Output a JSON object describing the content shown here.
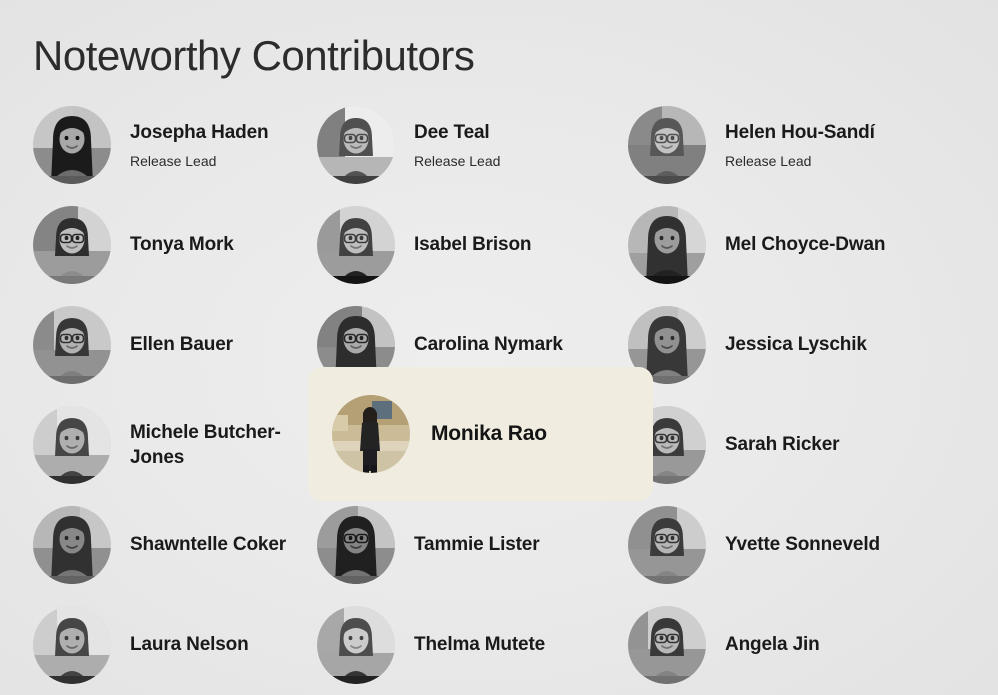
{
  "page": {
    "title": "Noteworthy Contributors",
    "background_color": "#e5e5e5",
    "title_color": "#2c2c2c"
  },
  "highlight": {
    "name": "Monika Rao",
    "background_color": "#f0ece0",
    "corner_radius": "14px"
  },
  "grid": {
    "columns": 3,
    "rows": 6,
    "rows_data": [
      [
        {
          "name": "Josepha Haden",
          "role": "Release Lead",
          "avatar": "avatar-josepha-haden"
        },
        {
          "name": "Dee Teal",
          "role": "Release Lead",
          "avatar": "avatar-dee-teal"
        },
        {
          "name": "Helen Hou-Sandí",
          "role": "Release Lead",
          "avatar": "avatar-helen-hou-sandi"
        }
      ],
      [
        {
          "name": "Tonya Mork",
          "role": "",
          "avatar": "avatar-tonya-mork"
        },
        {
          "name": "Isabel Brison",
          "role": "",
          "avatar": "avatar-isabel-brison"
        },
        {
          "name": "Mel Choyce-Dwan",
          "role": "",
          "avatar": "avatar-mel-choyce-dwan"
        }
      ],
      [
        {
          "name": "Ellen Bauer",
          "role": "",
          "avatar": "avatar-ellen-bauer"
        },
        {
          "name": "Carolina Nymark",
          "role": "",
          "avatar": "avatar-carolina-nymark"
        },
        {
          "name": "Jessica Lyschik",
          "role": "",
          "avatar": "avatar-jessica-lyschik"
        }
      ],
      [
        {
          "name": "Michele Butcher-Jones",
          "role": "",
          "avatar": "avatar-michele-butcher-jones"
        },
        {
          "name": "Monika Rao",
          "role": "",
          "avatar": "avatar-monika-rao",
          "highlighted": true
        },
        {
          "name": "Sarah Ricker",
          "role": "",
          "avatar": "avatar-sarah-ricker"
        }
      ],
      [
        {
          "name": "Shawntelle Coker",
          "role": "",
          "avatar": "avatar-shawntelle-coker"
        },
        {
          "name": "Tammie Lister",
          "role": "",
          "avatar": "avatar-tammie-lister"
        },
        {
          "name": "Yvette Sonneveld",
          "role": "",
          "avatar": "avatar-yvette-sonneveld"
        }
      ],
      [
        {
          "name": "Laura Nelson",
          "role": "",
          "avatar": "avatar-laura-nelson"
        },
        {
          "name": "Thelma Mutete",
          "role": "",
          "avatar": "avatar-thelma-mutete"
        },
        {
          "name": "Angela Jin",
          "role": "",
          "avatar": "avatar-angela-jin"
        }
      ]
    ]
  }
}
